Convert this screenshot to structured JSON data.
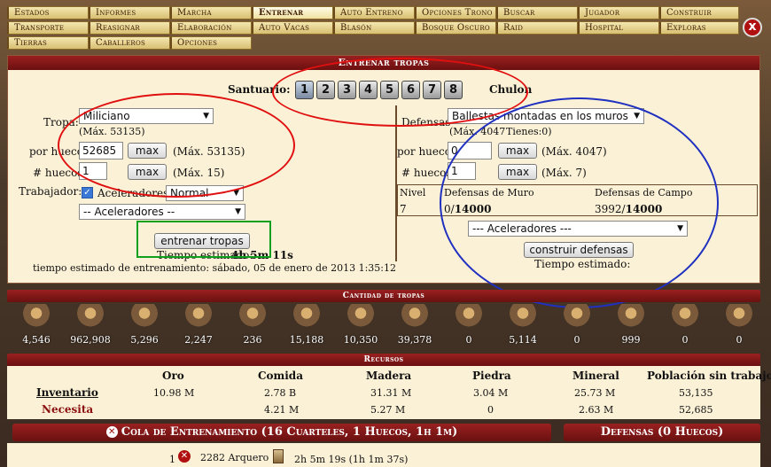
{
  "menu": {
    "row1": [
      "Estados",
      "Informes",
      "Marcha",
      "Entrenar",
      "Auto Entreno",
      "Opciones Trono",
      "Buscar",
      "Jugador",
      "Construir"
    ],
    "row2": [
      "Transporte",
      "Reasignar",
      "Elaboración",
      "Auto Vacas",
      "Blasón",
      "Bosque Oscuro",
      "Raid",
      "Hospital",
      "Exploras"
    ],
    "row3": [
      "Tierras",
      "Caballeros",
      "Opciones"
    ],
    "close": "x"
  },
  "panel": {
    "title": "Entrenar tropas",
    "sanctuary_label": "Santuario:",
    "sanctuary_buttons": [
      "1",
      "2",
      "3",
      "4",
      "5",
      "6",
      "7",
      "8"
    ],
    "city_name": "Chulon"
  },
  "train": {
    "troop_label": "Tropa:",
    "troop_value": "Miliciano",
    "troop_max": "(Máx. 53135)",
    "per_slot_label": "por hueco",
    "per_slot_value": "52685",
    "max_button": "max",
    "per_slot_max": "(Máx. 53135)",
    "slots_label": "# huecos",
    "slots_value": "1",
    "slots_max": "(Máx. 15)",
    "worker_label": "Trabajador:",
    "check": "✓",
    "accelerators_label": "Aceleradores:",
    "accelerators_value": "Normal",
    "accelerators_select": "-- Aceleradores --",
    "train_button": "entrenar tropas",
    "estimated_label": "Tiempo estimado:",
    "estimated_value": "4h 5m 11s",
    "estimated_end": "tiempo estimado de entrenamiento: sábado, 05 de enero de 2013 1:35:12"
  },
  "defense": {
    "label": "Defensas",
    "value": "Ballestas montadas en los muros",
    "max": "(Máx. 4047",
    "has": "Tienes:0)",
    "per_slot_label": "por hueco",
    "per_slot_value": "0",
    "max_button": "max",
    "per_slot_max": "(Máx. 4047)",
    "slots_label": "# huecos",
    "slots_value": "1",
    "slots_max": "(Máx. 7)",
    "table_head": [
      "Nivel",
      "Defensas de Muro",
      "Defensas de Campo"
    ],
    "level": "7",
    "wall_current": "0/",
    "wall_max": "14000",
    "field_current": "3992/",
    "field_max": "14000",
    "accelerators_select": "--- Aceleradores ---",
    "build_button": "construir defensas",
    "estimated_label": "Tiempo estimado:"
  },
  "troops": {
    "title": "Cantidad de tropas",
    "counts": [
      "4,546",
      "962,908",
      "5,296",
      "2,247",
      "236",
      "15,188",
      "10,350",
      "39,378",
      "0",
      "5,114",
      "0",
      "999",
      "0",
      "0"
    ]
  },
  "resources": {
    "title": "Recursos",
    "headers": [
      "Oro",
      "Comida",
      "Madera",
      "Piedra",
      "Mineral",
      "Población sin trabajo"
    ],
    "inventory_label": "Inventario",
    "inventory": [
      "10.98 M",
      "2.78 B",
      "31.31 M",
      "3.04 M",
      "25.73 M",
      "53,135"
    ],
    "needs_label": "Necesita",
    "needs": [
      "",
      "4.21 M",
      "5.27 M",
      "0",
      "2.63 M",
      "52,685"
    ]
  },
  "queue": {
    "title": "Cola de Entrenamiento (16 Cuarteles, 1 Huecos, 1h 1m)",
    "defense_title": "Defensas (0 Huecos)",
    "row_index": "1",
    "row_unit": "2282 Arquero",
    "row_time": "2h 5m 19s (1h 1m 37s)"
  },
  "colors": {
    "accent_red": "#8a1a1a",
    "menu_gold": "#e6cf88",
    "panel_bg": "#fbf1d6",
    "annotation_red": "#e01010",
    "annotation_blue": "#2030c0",
    "annotation_green": "#10a020"
  }
}
